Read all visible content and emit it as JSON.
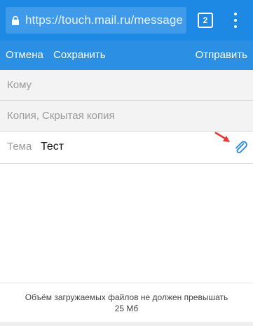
{
  "browser": {
    "url": "https://touch.mail.ru/message",
    "tab_count": "2"
  },
  "toolbar": {
    "cancel_label": "Отмена",
    "save_label": "Сохранить",
    "send_label": "Отправить"
  },
  "form": {
    "to_placeholder": "Кому",
    "cc_placeholder": "Копия, Скрытая копия",
    "subject_label": "Тема",
    "subject_value": "Тест"
  },
  "footer": {
    "note": "Объём загружаемых файлов не должен превышать 25 Мб"
  },
  "colors": {
    "browser_bar": "#1e88e5",
    "app_bar": "#2b8fe3",
    "attach_icon": "#1e88e5",
    "annotation_arrow": "#e53935"
  },
  "icons": [
    "lock-icon",
    "tabs-counter-icon",
    "more-vert-icon",
    "paperclip-icon",
    "red-arrow-annotation"
  ]
}
